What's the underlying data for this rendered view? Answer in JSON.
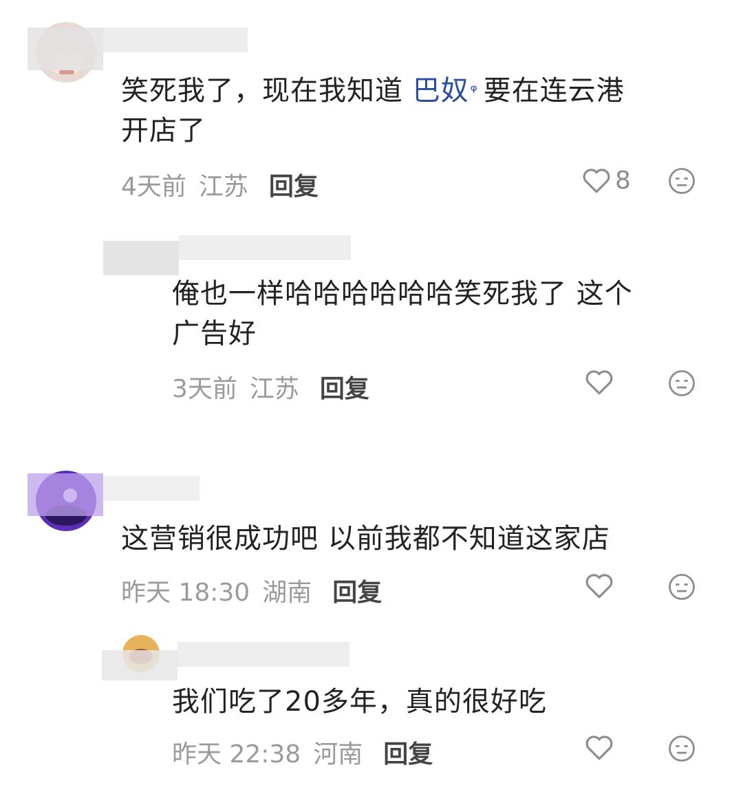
{
  "comments": [
    {
      "text_before": "笑死我了，现在我知道",
      "topic": "巴奴",
      "text_after": "要在连云港",
      "text_line2": "开店了",
      "time": "4天前",
      "region": "江苏",
      "reply_label": "回复",
      "like_count": "8"
    },
    {
      "line1": "俺也一样哈哈哈哈哈哈笑死我了 这个",
      "line2": "广告好",
      "time": "3天前",
      "region": "江苏",
      "reply_label": "回复"
    },
    {
      "line1": "这营销很成功吧 以前我都不知道这家店",
      "time": "昨天 18:30",
      "region": "湖南",
      "reply_label": "回复"
    },
    {
      "line1": "我们吃了20多年，真的很好吃",
      "time": "昨天 22:38",
      "region": "河南",
      "reply_label": "回复"
    }
  ],
  "icons": {
    "like": "heart-outline-icon",
    "dislike": "meh-face-icon",
    "topic": "search-icon"
  }
}
